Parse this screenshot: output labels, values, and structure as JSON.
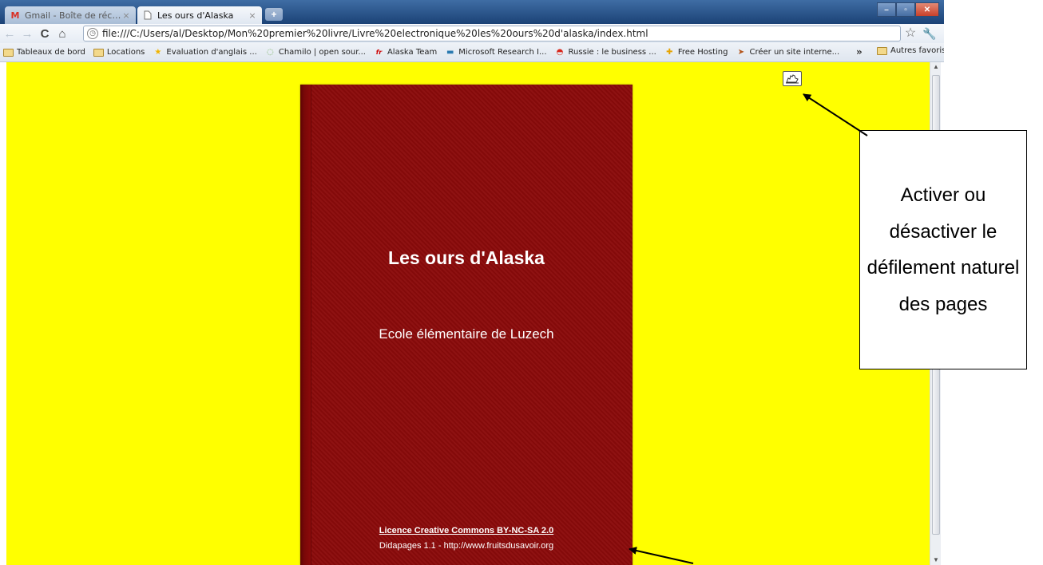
{
  "tabs": [
    {
      "label": "Gmail - Boîte de réceptio...",
      "icon": "gmail-icon",
      "active": false
    },
    {
      "label": "Les ours d'Alaska",
      "icon": "page-icon",
      "active": true
    }
  ],
  "address_bar": {
    "url": "file:///C:/Users/al/Desktop/Mon%20premier%20livre/Livre%20electronique%20les%20ours%20d'alaska/index.html"
  },
  "bookmarks": [
    {
      "label": "Tableaux de bord",
      "icon": "folder-icon"
    },
    {
      "label": "Locations",
      "icon": "folder-icon"
    },
    {
      "label": "Evaluation d'anglais ...",
      "icon": "star-icon"
    },
    {
      "label": "Chamilo | open sour...",
      "icon": "chamilo-icon"
    },
    {
      "label": "Alaska Team",
      "icon": "free-icon"
    },
    {
      "label": "Microsoft Research I...",
      "icon": "microsoft-icon"
    },
    {
      "label": "Russie : le business ...",
      "icon": "russia-icon"
    },
    {
      "label": "Free Hosting",
      "icon": "plus-icon"
    },
    {
      "label": "Créer un site interne...",
      "icon": "arrow-icon"
    }
  ],
  "bookmarks_other": "Autres favoris",
  "book": {
    "title": "Les ours d'Alaska",
    "subtitle": "Ecole élémentaire de Luzech",
    "licence": "Licence Creative Commons BY-NC-SA 2.0",
    "credit": "Didapages 1.1 - http://www.fruitsdusavoir.org"
  },
  "callout": {
    "text": "Activer ou désactiver le défilement naturel des pages"
  },
  "colors": {
    "page_background": "#ffff00",
    "book_cover": "#8b0a0a"
  }
}
